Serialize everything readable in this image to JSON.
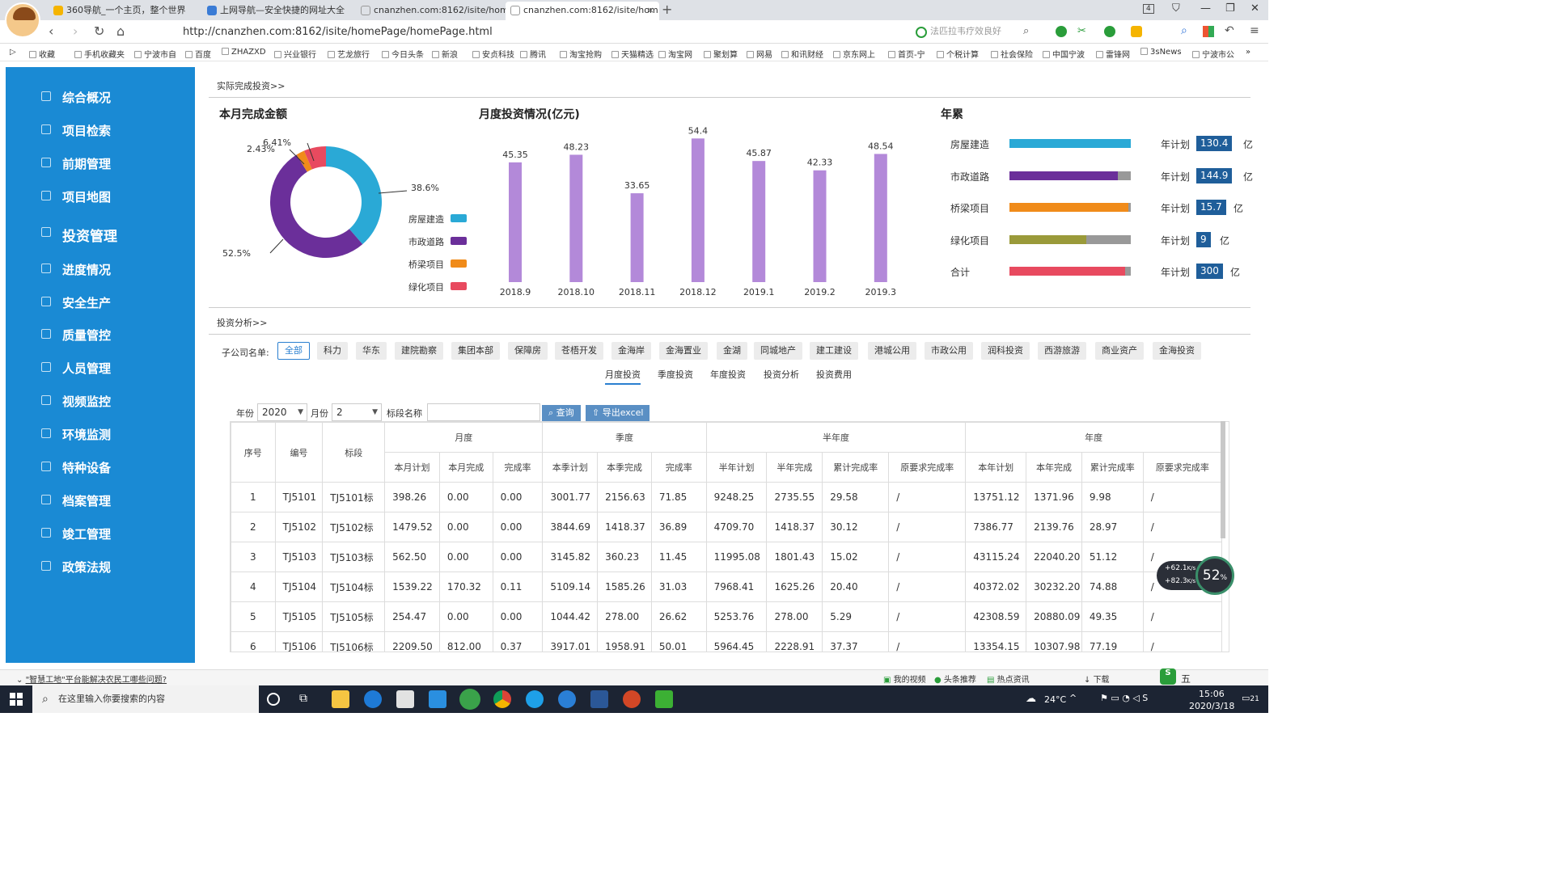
{
  "browser": {
    "tabs": [
      {
        "label": "360导航_一个主页，整个世界",
        "active": false
      },
      {
        "label": "上网导航—安全快捷的网址大全",
        "active": false
      },
      {
        "label": "cnanzhen.com:8162/isite/hom",
        "active": false
      },
      {
        "label": "cnanzhen.com:8162/isite/hom",
        "active": true
      }
    ],
    "tab_count": "4",
    "url": "http://cnanzhen.com:8162/isite/homePage/homePage.html",
    "search_placeholder": "法匹拉韦疗效良好",
    "bookmarks": [
      "收藏",
      "手机收藏夹",
      "宁波市自",
      "百度",
      "ZHAZXD",
      "兴业银行",
      "艺龙旅行",
      "今日头条",
      "新浪",
      "安贞科技",
      "腾讯",
      "淘宝抢购",
      "天猫精选",
      "淘宝网",
      "聚划算",
      "网易",
      "和讯财经",
      "京东网上",
      "首页-宁",
      "个税计算",
      "社会保险",
      "中国宁波",
      "雷锋网",
      "3sNews",
      "宁波市公"
    ]
  },
  "sidebar": {
    "items": [
      {
        "label": "综合概况",
        "icon": "dashboard-icon"
      },
      {
        "label": "项目检索",
        "icon": "list-icon"
      },
      {
        "label": "前期管理",
        "icon": "document-icon"
      },
      {
        "label": "项目地图",
        "icon": "map-icon"
      },
      {
        "label": "投资管理",
        "icon": "chart-icon",
        "active": true
      },
      {
        "label": "进度情况",
        "icon": "progress-icon"
      },
      {
        "label": "安全生产",
        "icon": "helmet-icon"
      },
      {
        "label": "质量管控",
        "icon": "gear-icon"
      },
      {
        "label": "人员管理",
        "icon": "user-icon"
      },
      {
        "label": "视频监控",
        "icon": "camera-icon"
      },
      {
        "label": "环境监测",
        "icon": "leaf-icon"
      },
      {
        "label": "特种设备",
        "icon": "crane-icon"
      },
      {
        "label": "档案管理",
        "icon": "archive-icon"
      },
      {
        "label": "竣工管理",
        "icon": "checklist-icon"
      },
      {
        "label": "政策法规",
        "icon": "book-icon"
      }
    ]
  },
  "top_section": {
    "title": "实际完成投资>>",
    "monthly_title": "本月完成金额",
    "chart_title": "月度投资情况(亿元)",
    "annual_title": "年累"
  },
  "chart_data": [
    {
      "type": "pie",
      "title": "本月完成金额",
      "categories": [
        "房屋建造",
        "市政道路",
        "桥梁项目",
        "绿化项目"
      ],
      "values": [
        38.6,
        52.5,
        2.43,
        6.41
      ],
      "labels": [
        "38.6%",
        "52.5%",
        "2.43%",
        "6.41%"
      ],
      "colors": [
        "#2aa9d6",
        "#6b2f9a",
        "#f08b1a",
        "#e84a5f"
      ],
      "legend": "right"
    },
    {
      "type": "bar",
      "title": "月度投资情况(亿元)",
      "categories": [
        "2018.9",
        "2018.10",
        "2018.11",
        "2018.12",
        "2019.1",
        "2019.2",
        "2019.3"
      ],
      "values": [
        45.35,
        48.23,
        33.65,
        54.4,
        45.87,
        42.33,
        48.54
      ],
      "labels": [
        "45.35",
        "48.23",
        "33.65",
        "54.4",
        "45.87",
        "42.33",
        "48.54"
      ],
      "color": "#b389d9",
      "ylim": [
        0,
        60
      ],
      "grid": false
    },
    {
      "type": "bar",
      "title": "年累",
      "categories": [
        "房屋建造",
        "市政道路",
        "桥梁项目",
        "绿化项目",
        "合计"
      ],
      "progress": [
        1.0,
        0.89,
        0.98,
        0.63,
        0.95
      ],
      "colors": [
        "#2aa9d6",
        "#6b2f9a",
        "#f08b1a",
        "#9a9a3a",
        "#e84a5f"
      ],
      "plan_label": "年计划",
      "plans": [
        "130.4",
        "144.9",
        "15.7",
        "9",
        "300"
      ],
      "unit": "亿"
    }
  ],
  "analysis": {
    "title": "投资分析>>",
    "company_label": "子公司名单:",
    "companies": [
      "全部",
      "科力",
      "华东",
      "建院勘察",
      "集团本部",
      "保障房",
      "苍梧开发",
      "金海岸",
      "金海置业",
      "金湖",
      "同城地产",
      "建工建设",
      "港城公用",
      "市政公用",
      "润科投资",
      "西游旅游",
      "商业资产",
      "金海投资"
    ],
    "subtabs": [
      "月度投资",
      "季度投资",
      "年度投资",
      "投资分析",
      "投资费用"
    ],
    "filter": {
      "year_label": "年份",
      "year": "2020",
      "month_label": "月份",
      "month": "2",
      "name_label": "标段名称",
      "query_btn": "查询",
      "export_btn": "导出excel"
    },
    "table": {
      "group_headers": [
        "序号",
        "编号",
        "标段",
        "月度",
        "季度",
        "半年度",
        "年度"
      ],
      "sub_headers": [
        "本月计划",
        "本月完成",
        "完成率",
        "本季计划",
        "本季完成",
        "完成率",
        "半年计划",
        "半年完成",
        "累计完成率",
        "原要求完成率",
        "本年计划",
        "本年完成",
        "累计完成率",
        "原要求完成率"
      ],
      "rows": [
        [
          "1",
          "TJ5101",
          "TJ5101标",
          "398.26",
          "0.00",
          "0.00",
          "3001.77",
          "2156.63",
          "71.85",
          "9248.25",
          "2735.55",
          "29.58",
          "/",
          "13751.12",
          "1371.96",
          "9.98",
          "/"
        ],
        [
          "2",
          "TJ5102",
          "TJ5102标",
          "1479.52",
          "0.00",
          "0.00",
          "3844.69",
          "1418.37",
          "36.89",
          "4709.70",
          "1418.37",
          "30.12",
          "/",
          "7386.77",
          "2139.76",
          "28.97",
          "/"
        ],
        [
          "3",
          "TJ5103",
          "TJ5103标",
          "562.50",
          "0.00",
          "0.00",
          "3145.82",
          "360.23",
          "11.45",
          "11995.08",
          "1801.43",
          "15.02",
          "/",
          "43115.24",
          "22040.20",
          "51.12",
          "/"
        ],
        [
          "4",
          "TJ5104",
          "TJ5104标",
          "1539.22",
          "170.32",
          "0.11",
          "5109.14",
          "1585.26",
          "31.03",
          "7968.41",
          "1625.26",
          "20.40",
          "/",
          "40372.02",
          "30232.20",
          "74.88",
          "/"
        ],
        [
          "5",
          "TJ5105",
          "TJ5105标",
          "254.47",
          "0.00",
          "0.00",
          "1044.42",
          "278.00",
          "26.62",
          "5253.76",
          "278.00",
          "5.29",
          "/",
          "42308.59",
          "20880.09",
          "49.35",
          "/"
        ],
        [
          "6",
          "TJ5106",
          "TJ5106标",
          "2209.50",
          "812.00",
          "0.37",
          "3917.01",
          "1958.91",
          "50.01",
          "5964.45",
          "2228.91",
          "37.37",
          "/",
          "13354.15",
          "10307.98",
          "77.19",
          "/"
        ]
      ]
    }
  },
  "speed_widget": {
    "up": "+62.1",
    "down": "+82.3",
    "unit": "K/s",
    "percent": "52",
    "percent_unit": "%"
  },
  "statusbar": {
    "news": "\"智慧工地\"平台能解决农民工哪些问题?",
    "items": [
      "我的视频",
      "头条推荐",
      "热点资讯",
      "下载"
    ],
    "ime": "五"
  },
  "taskbar": {
    "search_placeholder": "在这里输入你要搜索的内容",
    "temperature": "24°C",
    "time": "15:06",
    "date": "2020/3/18",
    "notif": "21"
  }
}
